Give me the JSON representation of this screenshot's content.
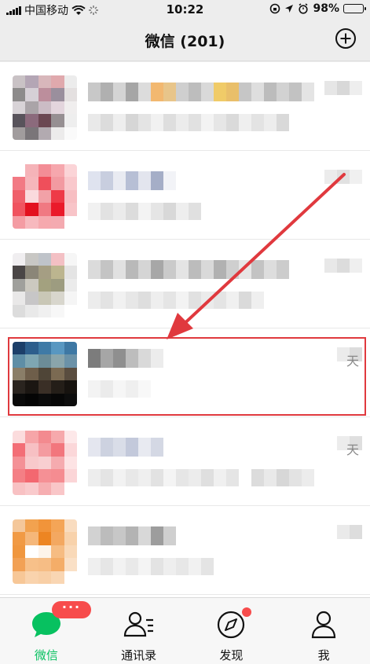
{
  "status_bar": {
    "carrier": "中国移动",
    "time": "10:22",
    "battery": "98%",
    "battery_level": 0.98
  },
  "header": {
    "title": "微信 (201)"
  },
  "chats": [
    {
      "day": ""
    },
    {
      "day": ""
    },
    {
      "day": ""
    },
    {
      "day": "天"
    },
    {
      "day": "天"
    },
    {
      "day": ""
    }
  ],
  "tabbar": {
    "items": [
      {
        "label": "微信",
        "badge": "···",
        "active": true
      },
      {
        "label": "通讯录"
      },
      {
        "label": "发现"
      },
      {
        "label": "我"
      }
    ]
  },
  "colors": {
    "accent": "#07c160",
    "badge": "#f74c4c",
    "highlight": "#e0393e"
  }
}
